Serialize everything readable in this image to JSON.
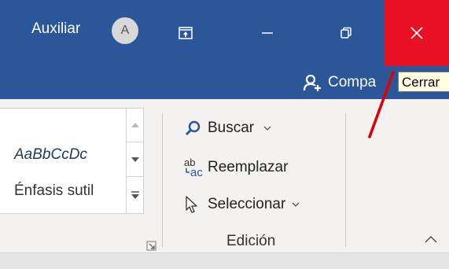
{
  "titlebar": {
    "user_name": "Auxiliar",
    "avatar_initial": "A",
    "close_tooltip": "Cerrar"
  },
  "ribbon_bar": {
    "share_label": "Compa"
  },
  "styles": {
    "preview_text": "AaBbCcDc",
    "style_name": "Énfasis sutil"
  },
  "editing": {
    "group_label": "Edición",
    "find_label": "Buscar",
    "replace_label": "Reemplazar",
    "select_label": "Seleccionar"
  },
  "icons": [
    "ribbon-display-icon",
    "minimize-icon",
    "restore-icon",
    "close-icon",
    "share-person-icon",
    "search-icon",
    "replace-icon",
    "select-cursor-icon",
    "dialog-launcher-icon",
    "collapse-ribbon-icon"
  ],
  "colors": {
    "titlebar": "#2b579a",
    "close_hover": "#e81123",
    "tooltip_bg": "#fffee0",
    "annotation": "#e00000"
  }
}
